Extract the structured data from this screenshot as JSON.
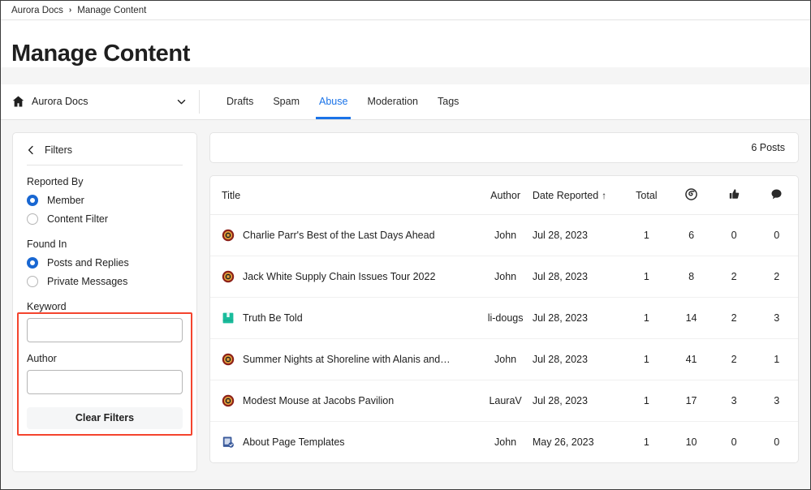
{
  "breadcrumb": {
    "root": "Aurora Docs",
    "separator": "›",
    "current": "Manage Content"
  },
  "header": {
    "title": "Manage Content"
  },
  "space_selector": {
    "icon": "home-icon",
    "label": "Aurora Docs",
    "chevron": "chevron-down-icon"
  },
  "tabs": [
    {
      "label": "Drafts",
      "active": false
    },
    {
      "label": "Spam",
      "active": false
    },
    {
      "label": "Abuse",
      "active": true
    },
    {
      "label": "Moderation",
      "active": false
    },
    {
      "label": "Tags",
      "active": false
    }
  ],
  "sidebar": {
    "back_icon": "chevron-left-icon",
    "title": "Filters",
    "groups": [
      {
        "label": "Reported By",
        "options": [
          {
            "label": "Member",
            "selected": true
          },
          {
            "label": "Content Filter",
            "selected": false
          }
        ]
      },
      {
        "label": "Found In",
        "options": [
          {
            "label": "Posts and Replies",
            "selected": true
          },
          {
            "label": "Private Messages",
            "selected": false
          }
        ]
      }
    ],
    "fields": [
      {
        "label": "Keyword",
        "value": "",
        "placeholder": ""
      },
      {
        "label": "Author",
        "value": "",
        "placeholder": ""
      }
    ],
    "clear_button": "Clear Filters",
    "highlight_color": "#f4442e"
  },
  "main": {
    "count_text": "6 Posts",
    "columns": [
      {
        "key": "title",
        "label": "Title",
        "type": "text",
        "sorted": false
      },
      {
        "key": "author",
        "label": "Author",
        "type": "text",
        "sorted": false
      },
      {
        "key": "date",
        "label": "Date Reported",
        "type": "text",
        "sorted": true,
        "sort_arrow": "↑"
      },
      {
        "key": "total",
        "label": "Total",
        "type": "text",
        "sorted": false
      },
      {
        "key": "views",
        "label": "",
        "type": "icon",
        "icon": "views-icon",
        "sorted": false
      },
      {
        "key": "likes",
        "label": "",
        "type": "icon",
        "icon": "thumbs-up-icon",
        "sorted": false
      },
      {
        "key": "replies",
        "label": "",
        "type": "icon",
        "icon": "comment-icon",
        "sorted": false
      }
    ],
    "rows": [
      {
        "icon": "discussion-icon",
        "icon_color": "#8c2018",
        "title": "Charlie Parr's Best of the Last Days Ahead",
        "author": "John",
        "date": "Jul 28, 2023",
        "total": "1",
        "views": "6",
        "likes": "0",
        "replies": "0"
      },
      {
        "icon": "discussion-icon",
        "icon_color": "#8c2018",
        "title": "Jack White Supply Chain Issues Tour 2022",
        "author": "John",
        "date": "Jul 28, 2023",
        "total": "1",
        "views": "8",
        "likes": "2",
        "replies": "2"
      },
      {
        "icon": "blog-icon",
        "icon_color": "#1abc9c",
        "title": "Truth Be Told",
        "author": "li-dougs",
        "date": "Jul 28, 2023",
        "total": "1",
        "views": "14",
        "likes": "2",
        "replies": "3"
      },
      {
        "icon": "discussion-icon",
        "icon_color": "#8c2018",
        "title": "Summer Nights at Shoreline with Alanis and…",
        "author": "John",
        "date": "Jul 28, 2023",
        "total": "1",
        "views": "41",
        "likes": "2",
        "replies": "1"
      },
      {
        "icon": "discussion-icon",
        "icon_color": "#8c2018",
        "title": "Modest Mouse at Jacobs Pavilion",
        "author": "LauraV",
        "date": "Jul 28, 2023",
        "total": "1",
        "views": "17",
        "likes": "3",
        "replies": "3"
      },
      {
        "icon": "page-approved-icon",
        "icon_color": "#3a5a9b",
        "title": "About Page Templates",
        "author": "John",
        "date": "May 26, 2023",
        "total": "1",
        "views": "10",
        "likes": "0",
        "replies": "0"
      }
    ]
  },
  "theme": {
    "accent": "#1a73e8",
    "radio_on": "#1967d2",
    "page_bg": "#f5f5f5",
    "card_bg": "#ffffff",
    "border": "#e4e4e4",
    "text": "#1f1f1f"
  }
}
